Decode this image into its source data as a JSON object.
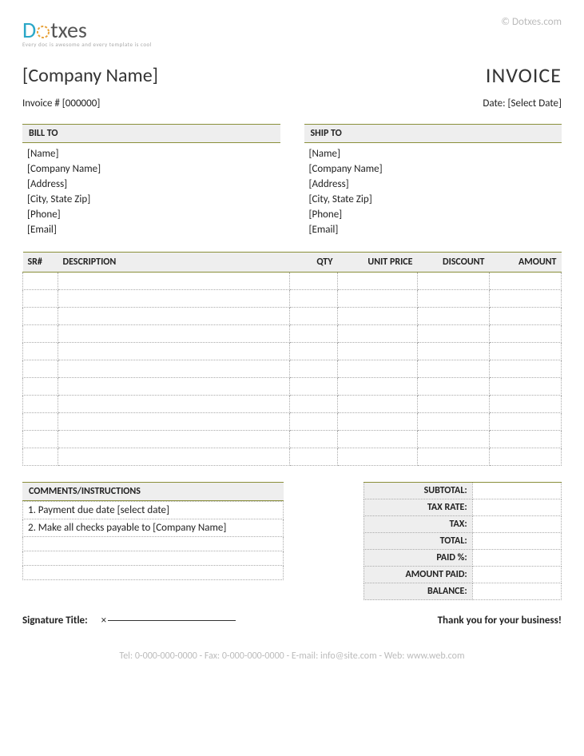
{
  "logo": {
    "part1": "D",
    "part2": "txes",
    "tagline": "Every doc is awesome and every template is cool"
  },
  "watermark": "© Dotxes.com",
  "header": {
    "company_name": "[Company Name]",
    "invoice_label": "INVOICE",
    "invoice_number_label": "Invoice # [000000]",
    "date_label": "Date: [Select Date]"
  },
  "bill_to": {
    "title": "BILL TO",
    "lines": [
      "[Name]",
      "[Company Name]",
      "[Address]",
      "[City, State Zip]",
      "[Phone]",
      "[Email]"
    ]
  },
  "ship_to": {
    "title": "SHIP TO",
    "lines": [
      "[Name]",
      "[Company Name]",
      "[Address]",
      "[City, State Zip]",
      "[Phone]",
      "[Email]"
    ]
  },
  "columns": {
    "sr": "SR#",
    "desc": "DESCRIPTION",
    "qty": "QTY",
    "unit": "UNIT PRICE",
    "disc": "DISCOUNT",
    "amt": "AMOUNT"
  },
  "comments": {
    "title": "COMMENTS/INSTRUCTIONS",
    "lines": [
      "1. Payment due date [select date]",
      "2. Make all checks payable to [Company Name]",
      "",
      "",
      ""
    ]
  },
  "totals": {
    "subtotal": "SUBTOTAL:",
    "tax_rate": "TAX RATE:",
    "tax": "TAX:",
    "total": "TOTAL:",
    "paid_pct": "PAID %:",
    "amount_paid": "AMOUNT PAID:",
    "balance": "BALANCE:"
  },
  "signature": {
    "label": "Signature Title:",
    "x": "×"
  },
  "thanks": "Thank you for your business!",
  "footer": "Tel: 0-000-000-0000  - Fax: 0-000-000-0000 - E-mail: info@site.com - Web: www.web.com"
}
